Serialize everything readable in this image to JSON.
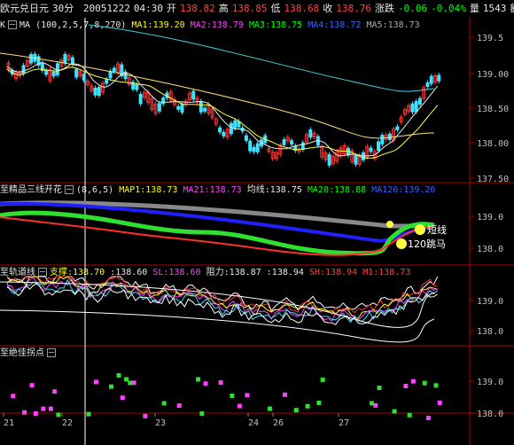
{
  "header": {
    "symbol": "欧元兑日元",
    "period": "30分",
    "date": "20051222",
    "time": "04:30",
    "open_label": "开",
    "open": "138.82",
    "high_label": "高",
    "high": "138.85",
    "low_label": "低",
    "low": "138.68",
    "close_label": "收",
    "close": "138.76",
    "change_label": "涨跌",
    "change": "-0.06",
    "change_pct": "-0.04%",
    "volume_label": "量",
    "volume": "1543",
    "amount_label": "额"
  },
  "panel_k": {
    "name": "K",
    "params": "MA (100,2,5,7,8,270)",
    "ma1": "MA1:139.20",
    "ma2": "MA2:138.79",
    "ma3": "MA3:138.75",
    "ma4": "MA4:138.72",
    "ma5": "MA5:138.73",
    "y_ticks": [
      "139.5",
      "139.00",
      "138.50",
      "138.00",
      "137.50"
    ]
  },
  "panel_jp": {
    "name": "至精品三线开花",
    "params": "(8,6,5)",
    "map1": "MAP1:138.73",
    "ma21": "MA21:138.73",
    "junxian": "均线:138.75",
    "ma20": "MA20:138.88",
    "ma120": "MA120:139.26",
    "ann_shortline": "短线",
    "ann_jump": "120跳马",
    "y_ticks": [
      "139.0",
      "138.0"
    ]
  },
  "panel_gd": {
    "name": "至轨道线",
    "support": "支撑:138.70",
    "support2": ":138.60",
    "sl": "SL:138.60",
    "resistance": "阻力:138.87",
    "resistance2": ":138.94",
    "sh": "SH:138.94",
    "m1": "M1:138.73",
    "y_ticks": [
      "139.0",
      "138.0"
    ]
  },
  "panel_gp": {
    "name": "至绝佳拐点",
    "y_ticks": [
      "139.0",
      "138.0"
    ]
  },
  "x_axis": {
    "labels": [
      "21",
      "22",
      "23",
      "24",
      "26",
      "27"
    ]
  },
  "colors": {
    "up": "#ff3030",
    "down": "#40e0ff",
    "ma_white": "#e8e8e8",
    "ma_yellow": "#ffe080",
    "ma_cyan": "#40d0e0",
    "gray": "#888888",
    "blue": "#2020ff",
    "green": "#30e030",
    "magenta": "#ff40ff",
    "axis": "#b00000"
  }
}
